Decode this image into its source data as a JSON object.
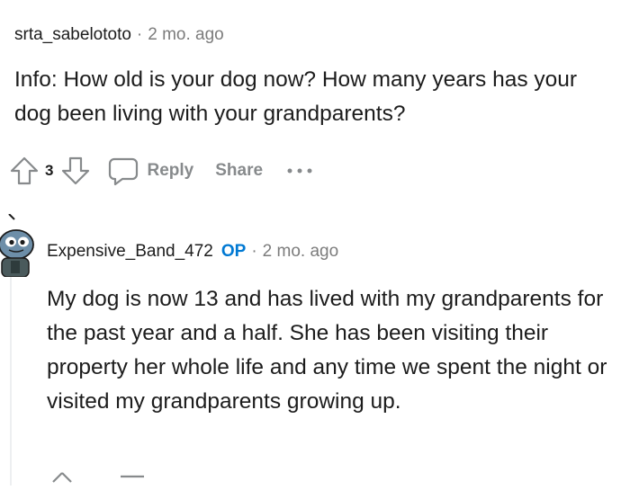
{
  "comment1": {
    "username": "srta_sabelototo",
    "separator": "·",
    "time": "2 mo. ago",
    "body": "Info: How old is your dog now? How many years has your dog been living with your grandparents?",
    "vote_count": "3",
    "reply_label": "Reply",
    "share_label": "Share",
    "more_label": "•••"
  },
  "comment2": {
    "username": "Expensive_Band_472",
    "op_badge": "OP",
    "separator": "·",
    "time": "2 mo. ago",
    "body": "My dog is now 13 and has lived with my grandparents for the past year and a half. She has been visiting their property her whole life and any time we spent the night or visited my grandparents growing up."
  },
  "icons": {
    "upvote": "upvote-arrow-icon",
    "downvote": "downvote-arrow-icon",
    "reply": "speech-bubble-icon",
    "avatar": "snoo-avatar"
  },
  "colors": {
    "text": "#1c1c1c",
    "muted": "#7c7c7c",
    "action": "#878a8c",
    "op_blue": "#0079d3",
    "thread_line": "#edeff1"
  }
}
